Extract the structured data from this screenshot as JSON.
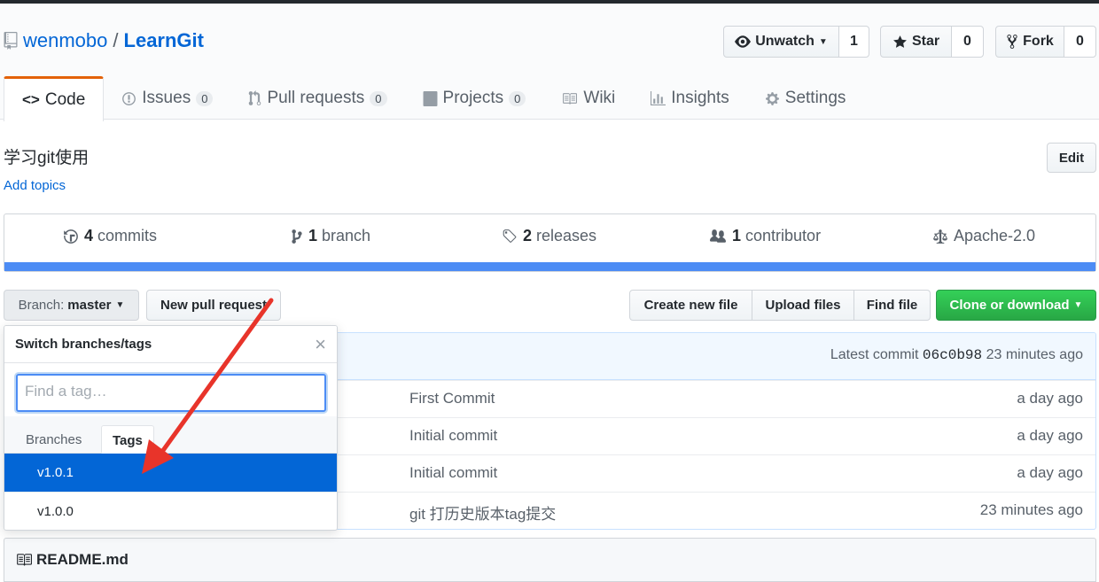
{
  "repo": {
    "owner": "wenmobo",
    "separator": "/",
    "name": "LearnGit"
  },
  "actions": {
    "watch_label": "Unwatch",
    "watch_count": "1",
    "star_label": "Star",
    "star_count": "0",
    "fork_label": "Fork",
    "fork_count": "0"
  },
  "tabs": [
    {
      "label": "Code",
      "icon": "code-icon"
    },
    {
      "label": "Issues",
      "count": "0",
      "icon": "issue-icon"
    },
    {
      "label": "Pull requests",
      "count": "0",
      "icon": "pull-request-icon"
    },
    {
      "label": "Projects",
      "count": "0",
      "icon": "project-icon"
    },
    {
      "label": "Wiki",
      "icon": "book-icon"
    },
    {
      "label": "Insights",
      "icon": "graph-icon"
    },
    {
      "label": "Settings",
      "icon": "gear-icon"
    }
  ],
  "description": "学习git使用",
  "add_topics": "Add topics",
  "edit_label": "Edit",
  "summary": {
    "commits_count": "4",
    "commits_label": "commits",
    "branch_count": "1",
    "branch_label": "branch",
    "releases_count": "2",
    "releases_label": "releases",
    "contributor_count": "1",
    "contributor_label": "contributor",
    "license": "Apache-2.0",
    "language_bar_color": "#4c8cf5"
  },
  "branch_select": {
    "prefix": "Branch:",
    "value": "master"
  },
  "new_pr_label": "New pull request",
  "file_actions": {
    "create": "Create new file",
    "upload": "Upload files",
    "find": "Find file",
    "clone": "Clone or download"
  },
  "latest_commit": {
    "prefix": "Latest commit",
    "sha": "06c0b98",
    "age": "23 minutes ago"
  },
  "files": [
    {
      "message": "First Commit",
      "age": "a day ago"
    },
    {
      "message": "Initial commit",
      "age": "a day ago"
    },
    {
      "message": "Initial commit",
      "age": "a day ago"
    },
    {
      "message": "git 打历史版本tag提交",
      "age": "23 minutes ago"
    }
  ],
  "readme": "README.md",
  "dropdown": {
    "title": "Switch branches/tags",
    "close": "×",
    "filter_placeholder": "Find a tag…",
    "tab_branches": "Branches",
    "tab_tags": "Tags",
    "items": [
      "v1.0.1",
      "v1.0.0"
    ]
  },
  "colors": {
    "accent": "#0366d6",
    "clone_green": "#28a745",
    "arrow_red": "#e8342a"
  }
}
